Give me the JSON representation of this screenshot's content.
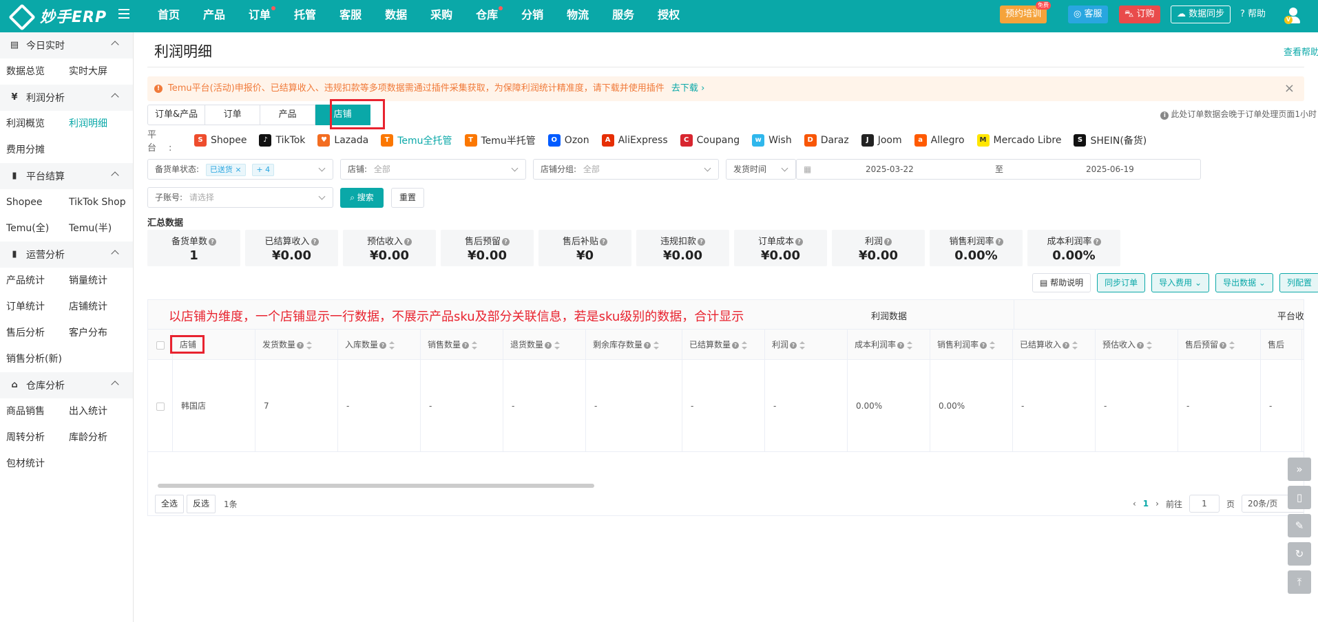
{
  "header": {
    "logo_text": "妙手ERP",
    "nav": [
      {
        "label": "首页",
        "dot": false
      },
      {
        "label": "产品",
        "dot": false
      },
      {
        "label": "订单",
        "dot": true
      },
      {
        "label": "托管",
        "dot": false
      },
      {
        "label": "客服",
        "dot": false
      },
      {
        "label": "数据",
        "dot": false
      },
      {
        "label": "采购",
        "dot": false
      },
      {
        "label": "仓库",
        "dot": true
      },
      {
        "label": "分销",
        "dot": false
      },
      {
        "label": "物流",
        "dot": false
      },
      {
        "label": "服务",
        "dot": false
      },
      {
        "label": "授权",
        "dot": false
      }
    ],
    "training_label": "预约培训",
    "training_badge": "免费",
    "service_label": "客服",
    "order_label": "订购",
    "sync_label": "数据同步",
    "help_label": "帮助",
    "avatar_badge": "V"
  },
  "sidebar": {
    "sections": [
      {
        "title": "今日实时",
        "icon": "calendar-icon",
        "items": [
          "数据总览",
          "实时大屏"
        ]
      },
      {
        "title": "利润分析",
        "icon": "profit-icon",
        "items": [
          "利润概览",
          "利润明细",
          "费用分摊"
        ]
      },
      {
        "title": "平台结算",
        "icon": "bar-chart-icon",
        "items": [
          "Shopee",
          "TikTok Shop",
          "Temu(全)",
          "Temu(半)"
        ]
      },
      {
        "title": "运营分析",
        "icon": "bar-chart-icon",
        "items": [
          "产品统计",
          "销量统计",
          "订单统计",
          "店铺统计",
          "售后分析",
          "客户分布",
          "销售分析(新)"
        ]
      },
      {
        "title": "仓库分析",
        "icon": "warehouse-icon",
        "items": [
          "商品销售",
          "出入统计",
          "周转分析",
          "库龄分析",
          "包材统计"
        ]
      }
    ],
    "active_item": "利润明细"
  },
  "page": {
    "title": "利润明细",
    "help_link": "查看帮助",
    "notice": "Temu平台(活动)申报价、已结算收入、违规扣款等多项数据需通过插件采集获取，为保障利润统计精准度，请下载并使用插件",
    "notice_link": "去下载",
    "tabs": [
      "订单&产品",
      "订单",
      "产品",
      "店铺"
    ],
    "active_tab": "店铺",
    "note_right": "此处订单数据会晚于订单处理页面1小时",
    "platform_label": "平台:",
    "platforms": [
      {
        "name": "Shopee",
        "color": "#ee4d2d",
        "glyph": "S"
      },
      {
        "name": "TikTok",
        "color": "#111111",
        "glyph": "♪"
      },
      {
        "name": "Lazada",
        "color": "#f36d21",
        "glyph": "♥"
      },
      {
        "name": "Temu全托管",
        "color": "#fb7701",
        "glyph": "T",
        "active": true
      },
      {
        "name": "Temu半托管",
        "color": "#fb7701",
        "glyph": "T"
      },
      {
        "name": "Ozon",
        "color": "#005bff",
        "glyph": "O"
      },
      {
        "name": "AliExpress",
        "color": "#e62e04",
        "glyph": "A"
      },
      {
        "name": "Coupang",
        "color": "#d8262f",
        "glyph": "C"
      },
      {
        "name": "Wish",
        "color": "#2fb7ec",
        "glyph": "w"
      },
      {
        "name": "Daraz",
        "color": "#f85606",
        "glyph": "D"
      },
      {
        "name": "Joom",
        "color": "#222222",
        "glyph": "J"
      },
      {
        "name": "Allegro",
        "color": "#ff5a00",
        "glyph": "a"
      },
      {
        "name": "Mercado Libre",
        "color": "#ffe600",
        "glyph": "M"
      },
      {
        "name": "SHEIN(备货)",
        "color": "#111111",
        "glyph": "S"
      }
    ],
    "filters": {
      "stock_status_label": "备货单状态:",
      "stock_status_tag": "已送货",
      "stock_status_more": "+ 4",
      "store_label": "店铺:",
      "store_value": "全部",
      "store_group_label": "店铺分组:",
      "store_group_value": "全部",
      "date_type": "发货时间",
      "date_start": "2025-03-22",
      "date_to": "至",
      "date_end": "2025-06-19",
      "subaccount_label": "子账号:",
      "subaccount_placeholder": "请选择",
      "search_label": "搜索",
      "reset_label": "重置"
    },
    "summary_title": "汇总数据",
    "summary": [
      {
        "label": "备货单数",
        "value": "1"
      },
      {
        "label": "已结算收入",
        "value": "¥0.00"
      },
      {
        "label": "预估收入",
        "value": "¥0.00"
      },
      {
        "label": "售后预留",
        "value": "¥0.00"
      },
      {
        "label": "售后补贴",
        "value": "¥0"
      },
      {
        "label": "违规扣款",
        "value": "¥0.00"
      },
      {
        "label": "订单成本",
        "value": "¥0.00"
      },
      {
        "label": "利润",
        "value": "¥0.00"
      },
      {
        "label": "销售利润率",
        "value": "0.00%"
      },
      {
        "label": "成本利润率",
        "value": "0.00%"
      }
    ],
    "actions": [
      "帮助说明",
      "同步订单",
      "导入费用",
      "导出数据",
      "列配置"
    ],
    "annotation": "以店铺为维度，一个店铺显示一行数据，不展示产品sku及部分关联信息，若是sku级别的数据，合计显示",
    "group_headers": [
      "利润数据",
      "平台收"
    ],
    "columns": [
      "店铺",
      "发货数量",
      "入库数量",
      "销售数量",
      "退货数量",
      "剩余库存数量",
      "已结算数量",
      "利润",
      "成本利润率",
      "销售利润率",
      "已结算收入",
      "预估收入",
      "售后预留",
      "售后"
    ],
    "row": [
      "韩国店",
      "7",
      "-",
      "-",
      "-",
      "-",
      "-",
      "-",
      "0.00%",
      "0.00%",
      "-",
      "-",
      "-",
      "-"
    ],
    "footer": {
      "select_all": "全选",
      "invert": "反选",
      "count": "1条",
      "page_current": "1",
      "goto_label": "前往",
      "goto_value": "1",
      "page_unit": "页",
      "page_size": "20条/页"
    }
  }
}
